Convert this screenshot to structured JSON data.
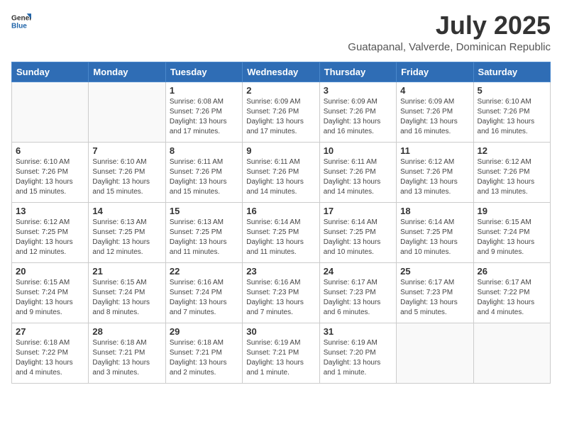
{
  "header": {
    "logo_general": "General",
    "logo_blue": "Blue",
    "title": "July 2025",
    "subtitle": "Guatapanal, Valverde, Dominican Republic"
  },
  "days_of_week": [
    "Sunday",
    "Monday",
    "Tuesday",
    "Wednesday",
    "Thursday",
    "Friday",
    "Saturday"
  ],
  "weeks": [
    [
      {
        "day": "",
        "info": ""
      },
      {
        "day": "",
        "info": ""
      },
      {
        "day": "1",
        "info": "Sunrise: 6:08 AM\nSunset: 7:26 PM\nDaylight: 13 hours and 17 minutes."
      },
      {
        "day": "2",
        "info": "Sunrise: 6:09 AM\nSunset: 7:26 PM\nDaylight: 13 hours and 17 minutes."
      },
      {
        "day": "3",
        "info": "Sunrise: 6:09 AM\nSunset: 7:26 PM\nDaylight: 13 hours and 16 minutes."
      },
      {
        "day": "4",
        "info": "Sunrise: 6:09 AM\nSunset: 7:26 PM\nDaylight: 13 hours and 16 minutes."
      },
      {
        "day": "5",
        "info": "Sunrise: 6:10 AM\nSunset: 7:26 PM\nDaylight: 13 hours and 16 minutes."
      }
    ],
    [
      {
        "day": "6",
        "info": "Sunrise: 6:10 AM\nSunset: 7:26 PM\nDaylight: 13 hours and 15 minutes."
      },
      {
        "day": "7",
        "info": "Sunrise: 6:10 AM\nSunset: 7:26 PM\nDaylight: 13 hours and 15 minutes."
      },
      {
        "day": "8",
        "info": "Sunrise: 6:11 AM\nSunset: 7:26 PM\nDaylight: 13 hours and 15 minutes."
      },
      {
        "day": "9",
        "info": "Sunrise: 6:11 AM\nSunset: 7:26 PM\nDaylight: 13 hours and 14 minutes."
      },
      {
        "day": "10",
        "info": "Sunrise: 6:11 AM\nSunset: 7:26 PM\nDaylight: 13 hours and 14 minutes."
      },
      {
        "day": "11",
        "info": "Sunrise: 6:12 AM\nSunset: 7:26 PM\nDaylight: 13 hours and 13 minutes."
      },
      {
        "day": "12",
        "info": "Sunrise: 6:12 AM\nSunset: 7:26 PM\nDaylight: 13 hours and 13 minutes."
      }
    ],
    [
      {
        "day": "13",
        "info": "Sunrise: 6:12 AM\nSunset: 7:25 PM\nDaylight: 13 hours and 12 minutes."
      },
      {
        "day": "14",
        "info": "Sunrise: 6:13 AM\nSunset: 7:25 PM\nDaylight: 13 hours and 12 minutes."
      },
      {
        "day": "15",
        "info": "Sunrise: 6:13 AM\nSunset: 7:25 PM\nDaylight: 13 hours and 11 minutes."
      },
      {
        "day": "16",
        "info": "Sunrise: 6:14 AM\nSunset: 7:25 PM\nDaylight: 13 hours and 11 minutes."
      },
      {
        "day": "17",
        "info": "Sunrise: 6:14 AM\nSunset: 7:25 PM\nDaylight: 13 hours and 10 minutes."
      },
      {
        "day": "18",
        "info": "Sunrise: 6:14 AM\nSunset: 7:25 PM\nDaylight: 13 hours and 10 minutes."
      },
      {
        "day": "19",
        "info": "Sunrise: 6:15 AM\nSunset: 7:24 PM\nDaylight: 13 hours and 9 minutes."
      }
    ],
    [
      {
        "day": "20",
        "info": "Sunrise: 6:15 AM\nSunset: 7:24 PM\nDaylight: 13 hours and 9 minutes."
      },
      {
        "day": "21",
        "info": "Sunrise: 6:15 AM\nSunset: 7:24 PM\nDaylight: 13 hours and 8 minutes."
      },
      {
        "day": "22",
        "info": "Sunrise: 6:16 AM\nSunset: 7:24 PM\nDaylight: 13 hours and 7 minutes."
      },
      {
        "day": "23",
        "info": "Sunrise: 6:16 AM\nSunset: 7:23 PM\nDaylight: 13 hours and 7 minutes."
      },
      {
        "day": "24",
        "info": "Sunrise: 6:17 AM\nSunset: 7:23 PM\nDaylight: 13 hours and 6 minutes."
      },
      {
        "day": "25",
        "info": "Sunrise: 6:17 AM\nSunset: 7:23 PM\nDaylight: 13 hours and 5 minutes."
      },
      {
        "day": "26",
        "info": "Sunrise: 6:17 AM\nSunset: 7:22 PM\nDaylight: 13 hours and 4 minutes."
      }
    ],
    [
      {
        "day": "27",
        "info": "Sunrise: 6:18 AM\nSunset: 7:22 PM\nDaylight: 13 hours and 4 minutes."
      },
      {
        "day": "28",
        "info": "Sunrise: 6:18 AM\nSunset: 7:21 PM\nDaylight: 13 hours and 3 minutes."
      },
      {
        "day": "29",
        "info": "Sunrise: 6:18 AM\nSunset: 7:21 PM\nDaylight: 13 hours and 2 minutes."
      },
      {
        "day": "30",
        "info": "Sunrise: 6:19 AM\nSunset: 7:21 PM\nDaylight: 13 hours and 1 minute."
      },
      {
        "day": "31",
        "info": "Sunrise: 6:19 AM\nSunset: 7:20 PM\nDaylight: 13 hours and 1 minute."
      },
      {
        "day": "",
        "info": ""
      },
      {
        "day": "",
        "info": ""
      }
    ]
  ]
}
